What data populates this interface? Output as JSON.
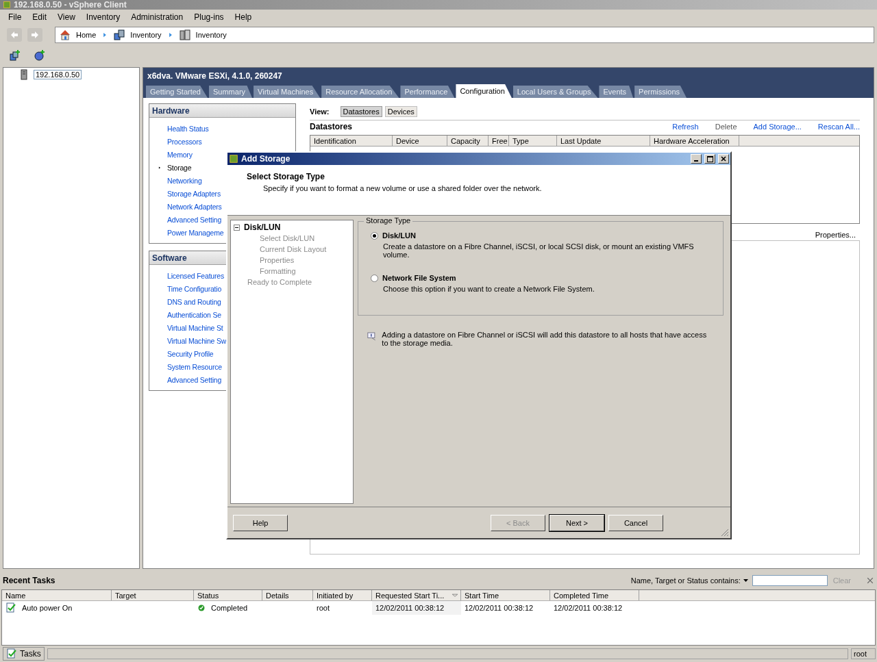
{
  "window": {
    "title": "192.168.0.50 - vSphere Client"
  },
  "menu": [
    "File",
    "Edit",
    "View",
    "Inventory",
    "Administration",
    "Plug-ins",
    "Help"
  ],
  "breadcrumb": [
    "Home",
    "Inventory",
    "Inventory"
  ],
  "tree": {
    "host": "192.168.0.50",
    "selected": true
  },
  "host_header": "x6dva. VMware ESXi, 4.1.0, 260247",
  "tabs": [
    {
      "label": "Getting Started",
      "selected": false
    },
    {
      "label": "Summary",
      "selected": false
    },
    {
      "label": "Virtual Machines",
      "selected": false
    },
    {
      "label": "Resource Allocation",
      "selected": false
    },
    {
      "label": "Performance",
      "selected": false
    },
    {
      "label": "Configuration",
      "selected": true
    },
    {
      "label": "Local Users & Groups",
      "selected": false
    },
    {
      "label": "Events",
      "selected": false
    },
    {
      "label": "Permissions",
      "selected": false
    }
  ],
  "hardware": {
    "title": "Hardware",
    "items": [
      {
        "label": "Health Status",
        "selected": false
      },
      {
        "label": "Processors",
        "selected": false
      },
      {
        "label": "Memory",
        "selected": false
      },
      {
        "label": "Storage",
        "selected": true
      },
      {
        "label": "Networking",
        "selected": false
      },
      {
        "label": "Storage Adapters",
        "selected": false
      },
      {
        "label": "Network Adapters",
        "selected": false
      },
      {
        "label": "Advanced Setting",
        "selected": false
      },
      {
        "label": "Power Manageme",
        "selected": false
      }
    ]
  },
  "software": {
    "title": "Software",
    "items": [
      {
        "label": "Licensed Features",
        "selected": false
      },
      {
        "label": "Time Configuratio",
        "selected": false
      },
      {
        "label": "DNS and Routing",
        "selected": false
      },
      {
        "label": "Authentication Se",
        "selected": false
      },
      {
        "label": "Virtual Machine St",
        "selected": false
      },
      {
        "label": "Virtual Machine Sw",
        "selected": false
      },
      {
        "label": "Security Profile",
        "selected": false
      },
      {
        "label": "System Resource",
        "selected": false
      },
      {
        "label": "Advanced Setting",
        "selected": false
      }
    ]
  },
  "view": {
    "label": "View:",
    "options": [
      {
        "label": "Datastores",
        "selected": true
      },
      {
        "label": "Devices",
        "selected": false
      }
    ]
  },
  "datastores": {
    "title": "Datastores",
    "actions": [
      {
        "label": "Refresh",
        "disabled": false
      },
      {
        "label": "Delete",
        "disabled": true
      },
      {
        "label": "Add Storage...",
        "disabled": false
      },
      {
        "label": "Rescan All...",
        "disabled": false
      }
    ],
    "columns": [
      "Identification",
      "Device",
      "Capacity",
      "Free",
      "Type",
      "Last Update",
      "Hardware Acceleration"
    ],
    "properties_link": "Properties..."
  },
  "dialog": {
    "title": "Add Storage",
    "heading": "Select Storage Type",
    "subheading": "Specify if you want to format a new volume or use a shared folder over the network.",
    "steps": [
      {
        "label": "Disk/LUN",
        "current": true,
        "expanded": true,
        "children": [
          {
            "label": "Select Disk/LUN",
            "current": false
          },
          {
            "label": "Current Disk Layout",
            "current": false
          },
          {
            "label": "Properties",
            "current": false
          },
          {
            "label": "Formatting",
            "current": false
          }
        ]
      },
      {
        "label": "Ready to Complete",
        "current": false
      }
    ],
    "group_label": "Storage Type",
    "options": [
      {
        "label": "Disk/LUN",
        "description": "Create a datastore on a Fibre Channel, iSCSI, or local SCSI disk, or mount an existing VMFS volume.",
        "selected": true
      },
      {
        "label": "Network File System",
        "description": "Choose this option if you want to create a Network File System.",
        "selected": false
      }
    ],
    "info": "Adding a datastore on Fibre Channel or iSCSI will add this datastore to all hosts that have access to the storage media.",
    "buttons": [
      {
        "label": "Help",
        "disabled": false,
        "default": false
      },
      {
        "label": "< Back",
        "disabled": true,
        "default": false
      },
      {
        "label": "Next >",
        "disabled": false,
        "default": true
      },
      {
        "label": "Cancel",
        "disabled": false,
        "default": false
      }
    ]
  },
  "recent_tasks": {
    "title": "Recent Tasks",
    "filter_label": "Name, Target or Status contains:",
    "clear": "Clear",
    "columns": [
      "Name",
      "Target",
      "Status",
      "Details",
      "Initiated by",
      "Requested Start Ti...",
      "Start Time",
      "Completed Time"
    ],
    "rows": [
      {
        "name": "Auto power On",
        "status": "Completed",
        "initiated_by": "root",
        "requested_start": "12/02/2011 00:38:12",
        "start_time": "12/02/2011 00:38:12",
        "completed_time": "12/02/2011 00:38:12"
      }
    ]
  },
  "status_bar": {
    "tasks": "Tasks",
    "user": "root"
  }
}
